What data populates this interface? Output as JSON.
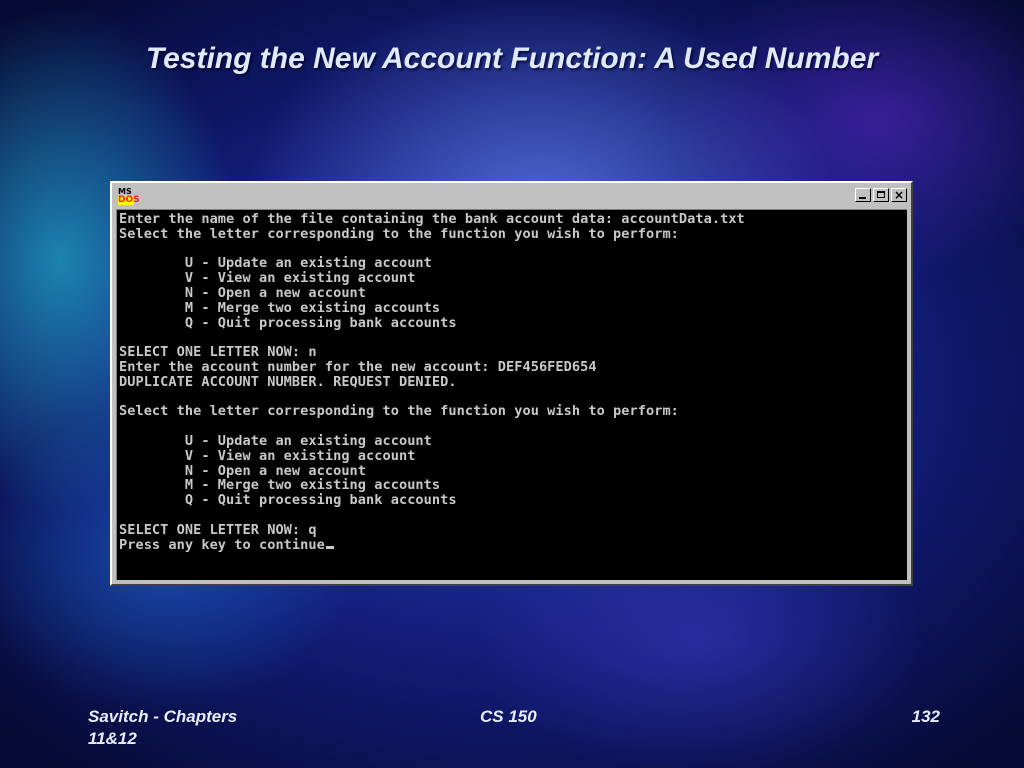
{
  "slide": {
    "title": "Testing the New Account Function: A Used Number"
  },
  "window": {
    "icon_top": "MS",
    "icon_bottom": "DOS",
    "buttons": {
      "minimize": "minimize-icon",
      "maximize": "maximize-icon",
      "close": "close-icon",
      "close_glyph": "×"
    }
  },
  "console": {
    "lines": [
      "Enter the name of the file containing the bank account data: accountData.txt",
      "Select the letter corresponding to the function you wish to perform:",
      "",
      "        U - Update an existing account",
      "        V - View an existing account",
      "        N - Open a new account",
      "        M - Merge two existing accounts",
      "        Q - Quit processing bank accounts",
      "",
      "SELECT ONE LETTER NOW: n",
      "Enter the account number for the new account: DEF456FED654",
      "DUPLICATE ACCOUNT NUMBER. REQUEST DENIED.",
      "",
      "Select the letter corresponding to the function you wish to perform:",
      "",
      "        U - Update an existing account",
      "        V - View an existing account",
      "        N - Open a new account",
      "        M - Merge two existing accounts",
      "        Q - Quit processing bank accounts",
      "",
      "SELECT ONE LETTER NOW: q",
      "Press any key to continue"
    ]
  },
  "footer": {
    "left": "Savitch - Chapters 11&12",
    "center": "CS 150",
    "right": "132"
  },
  "colors": {
    "console_bg": "#000000",
    "console_text": "#c8c8c8",
    "window_chrome": "#c0c0c0",
    "title_text": "#e0eaff"
  }
}
